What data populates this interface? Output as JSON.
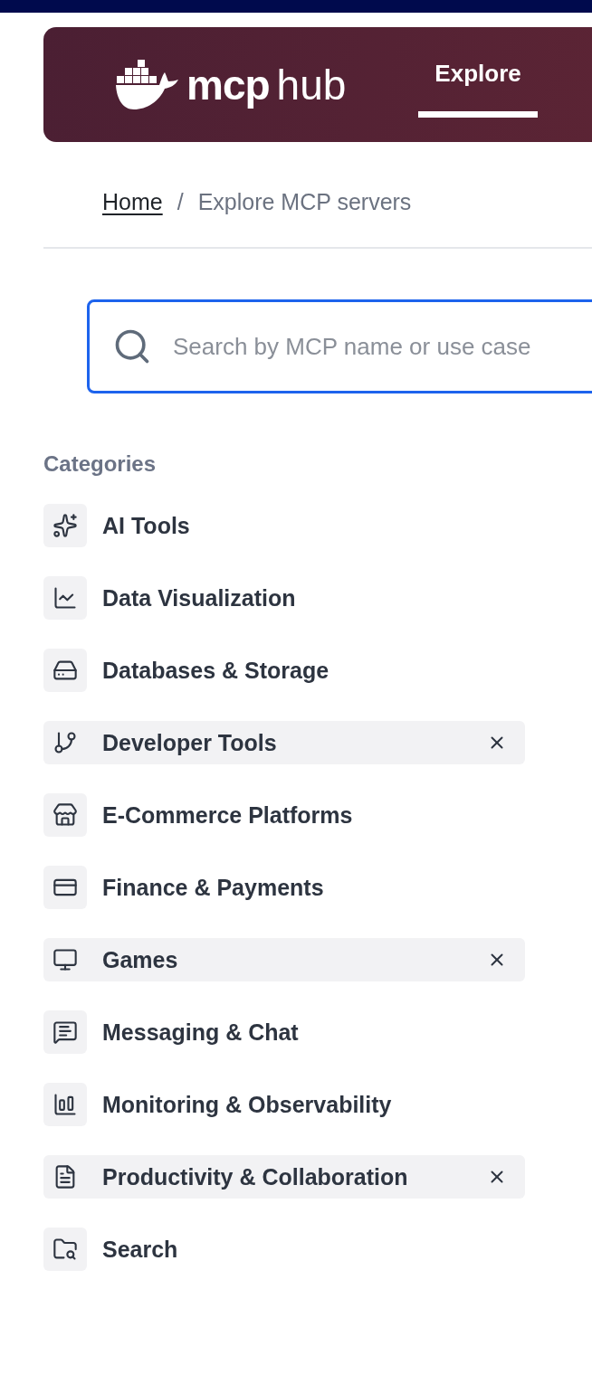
{
  "header": {
    "logo": {
      "strong": "mcp",
      "light": "hub"
    },
    "tabs": [
      {
        "label": "Explore",
        "selected": true
      }
    ]
  },
  "breadcrumb": {
    "items": [
      {
        "label": "Home",
        "link": true
      },
      {
        "label": "Explore MCP servers",
        "link": false
      }
    ],
    "separator": "/"
  },
  "search": {
    "placeholder": "Search by MCP name or use case"
  },
  "categories": {
    "title": "Categories",
    "items": [
      {
        "label": "AI Tools",
        "selected": false
      },
      {
        "label": "Data Visualization",
        "selected": false
      },
      {
        "label": "Databases & Storage",
        "selected": false
      },
      {
        "label": "Developer Tools",
        "selected": true
      },
      {
        "label": "E-Commerce Platforms",
        "selected": false
      },
      {
        "label": "Finance & Payments",
        "selected": false
      },
      {
        "label": "Games",
        "selected": true
      },
      {
        "label": "Messaging & Chat",
        "selected": false
      },
      {
        "label": "Monitoring & Observability",
        "selected": false
      },
      {
        "label": "Productivity & Collaboration",
        "selected": true
      },
      {
        "label": "Search",
        "selected": false
      }
    ]
  }
}
